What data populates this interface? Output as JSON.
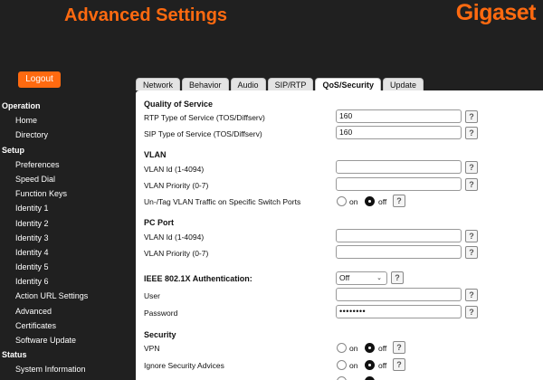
{
  "header": {
    "title": "Advanced Settings",
    "brand": "Gigaset"
  },
  "logout_label": "Logout",
  "nav": {
    "operation": "Operation",
    "home": "Home",
    "directory": "Directory",
    "setup": "Setup",
    "preferences": "Preferences",
    "speed_dial": "Speed Dial",
    "function_keys": "Function Keys",
    "identity1": "Identity 1",
    "identity2": "Identity 2",
    "identity3": "Identity 3",
    "identity4": "Identity 4",
    "identity5": "Identity 5",
    "identity6": "Identity 6",
    "action_url": "Action URL Settings",
    "advanced": "Advanced",
    "certificates": "Certificates",
    "software_update": "Software Update",
    "status": "Status",
    "system_information": "System Information"
  },
  "tabs": [
    "Network",
    "Behavior",
    "Audio",
    "SIP/RTP",
    "QoS/Security",
    "Update"
  ],
  "active_tab": "QoS/Security",
  "qos": {
    "heading": "Quality of Service",
    "rtp_label": "RTP Type of Service (TOS/Diffserv)",
    "rtp_value": "160",
    "sip_label": "SIP Type of Service (TOS/Diffserv)",
    "sip_value": "160"
  },
  "vlan": {
    "heading": "VLAN",
    "id_label": "VLAN Id (1-4094)",
    "id_value": "",
    "priority_label": "VLAN Priority (0-7)",
    "priority_value": "",
    "untag_label": "Un-/Tag VLAN Traffic on Specific Switch Ports",
    "untag_selected": "off"
  },
  "pc_port": {
    "heading": "PC Port",
    "id_label": "VLAN Id (1-4094)",
    "id_value": "",
    "priority_label": "VLAN Priority (0-7)",
    "priority_value": ""
  },
  "ieee": {
    "label": "IEEE 802.1X Authentication:",
    "selected": "Off",
    "user_label": "User",
    "user_value": "",
    "password_label": "Password",
    "password_value": "••••••••"
  },
  "security": {
    "heading": "Security",
    "vpn_label": "VPN",
    "vpn_selected": "off",
    "ignore_label": "Ignore Security Advices",
    "ignore_selected": "off"
  },
  "radio_on": "on",
  "radio_off": "off",
  "help_glyph": "?"
}
